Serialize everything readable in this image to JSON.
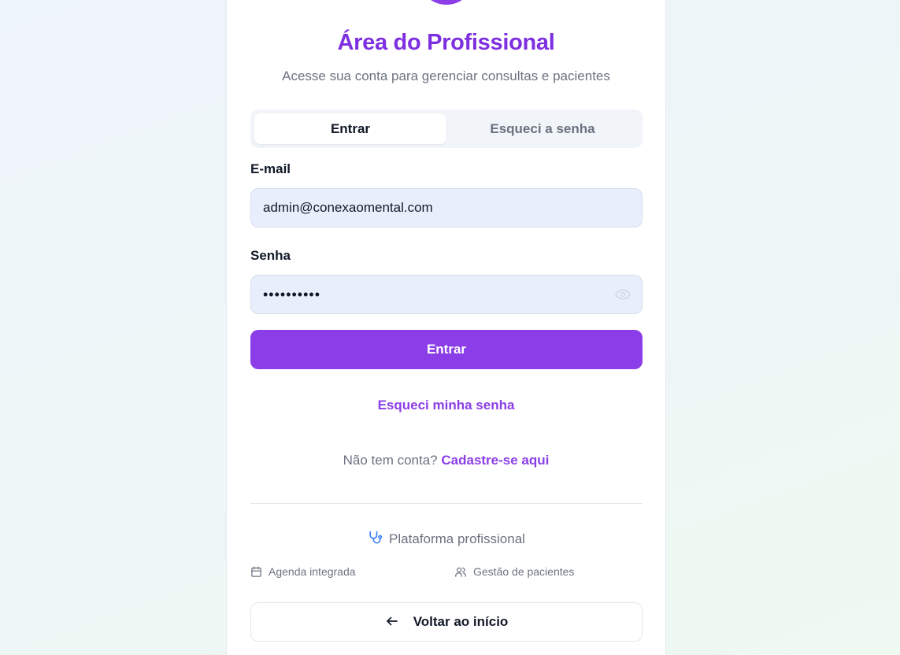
{
  "header": {
    "title": "Área do Profissional",
    "subtitle": "Acesse sua conta para gerenciar consultas e pacientes"
  },
  "tabs": [
    {
      "label": "Entrar",
      "active": true
    },
    {
      "label": "Esqueci a senha",
      "active": false
    }
  ],
  "form": {
    "email_label": "E-mail",
    "email_value": "admin@conexaomental.com",
    "password_label": "Senha",
    "password_value": "••••••••••",
    "submit_label": "Entrar"
  },
  "links": {
    "forgot_password": "Esqueci minha senha",
    "no_account_text": "Não tem conta?",
    "signup": "Cadastre-se aqui"
  },
  "platform": {
    "label": "Plataforma profissional",
    "features": [
      {
        "icon": "calendar-icon",
        "label": "Agenda integrada"
      },
      {
        "icon": "users-icon",
        "label": "Gestão de pacientes"
      }
    ]
  },
  "back_button": {
    "label": "Voltar ao início",
    "icon": "arrow-left-icon"
  },
  "colors": {
    "primary": "#8b3ee8",
    "title": "#7e2fe0",
    "input_bg": "#e8effc",
    "muted_text": "#6b7280",
    "platform_icon": "#3b82f6"
  }
}
